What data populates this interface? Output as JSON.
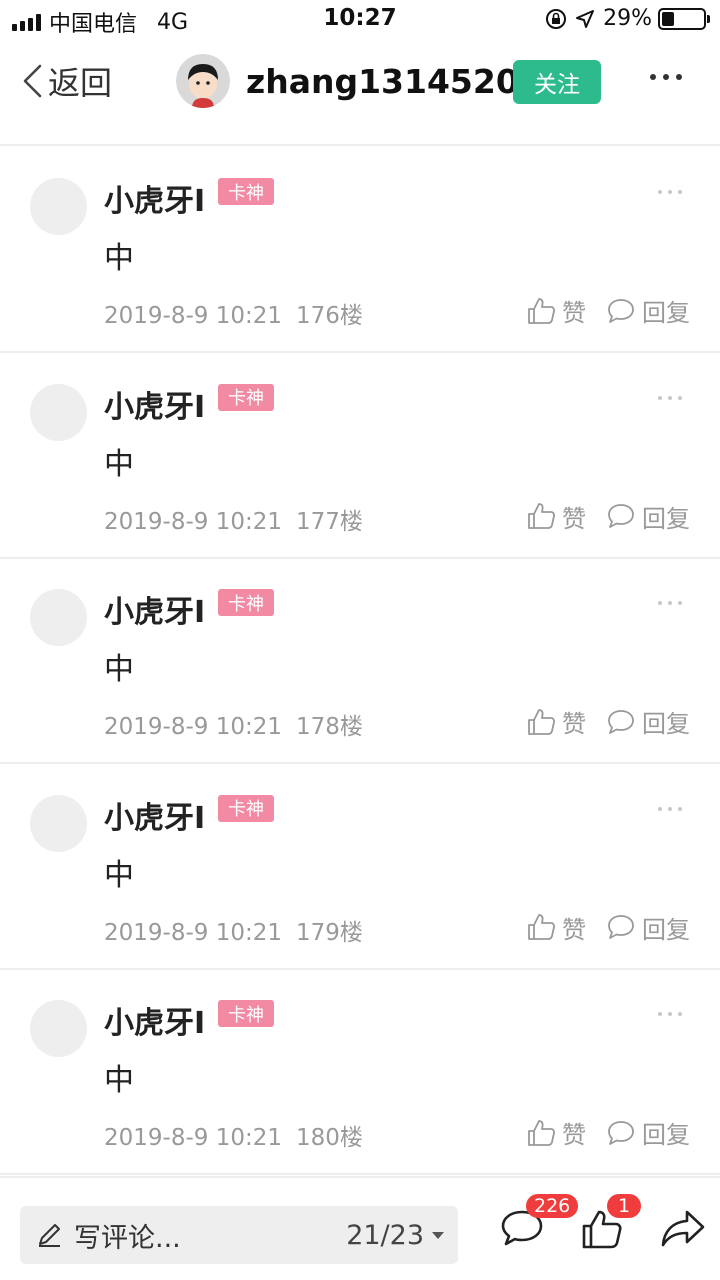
{
  "status_bar": {
    "carrier": "中国电信",
    "network": "4G",
    "time": "10:27",
    "battery": "29%",
    "battery_level": 0.29
  },
  "nav": {
    "back_label": "返回",
    "author": "zhang1314520",
    "follow_label": "关注"
  },
  "comments": [
    {
      "name": "小虎牙I",
      "badge": "卡神",
      "text": "中",
      "date": "2019-8-9 10:21",
      "floor": "176楼",
      "like": "赞",
      "reply": "回复"
    },
    {
      "name": "小虎牙I",
      "badge": "卡神",
      "text": "中",
      "date": "2019-8-9 10:21",
      "floor": "177楼",
      "like": "赞",
      "reply": "回复"
    },
    {
      "name": "小虎牙I",
      "badge": "卡神",
      "text": "中",
      "date": "2019-8-9 10:21",
      "floor": "178楼",
      "like": "赞",
      "reply": "回复"
    },
    {
      "name": "小虎牙I",
      "badge": "卡神",
      "text": "中",
      "date": "2019-8-9 10:21",
      "floor": "179楼",
      "like": "赞",
      "reply": "回复"
    },
    {
      "name": "小虎牙I",
      "badge": "卡神",
      "text": "中",
      "date": "2019-8-9 10:21",
      "floor": "180楼",
      "like": "赞",
      "reply": "回复"
    }
  ],
  "bottom_bar": {
    "placeholder": "写评论...",
    "pager": "21/23",
    "comment_count": "226",
    "like_count": "1"
  },
  "colors": {
    "follow": "#2dba8c",
    "badge": "#f28aa4",
    "notification": "#f03c3c"
  },
  "icons": [
    "back-chevron-icon",
    "more-icon",
    "thumb-up-icon",
    "comment-bubble-icon",
    "pen-icon",
    "share-arrow-icon"
  ]
}
